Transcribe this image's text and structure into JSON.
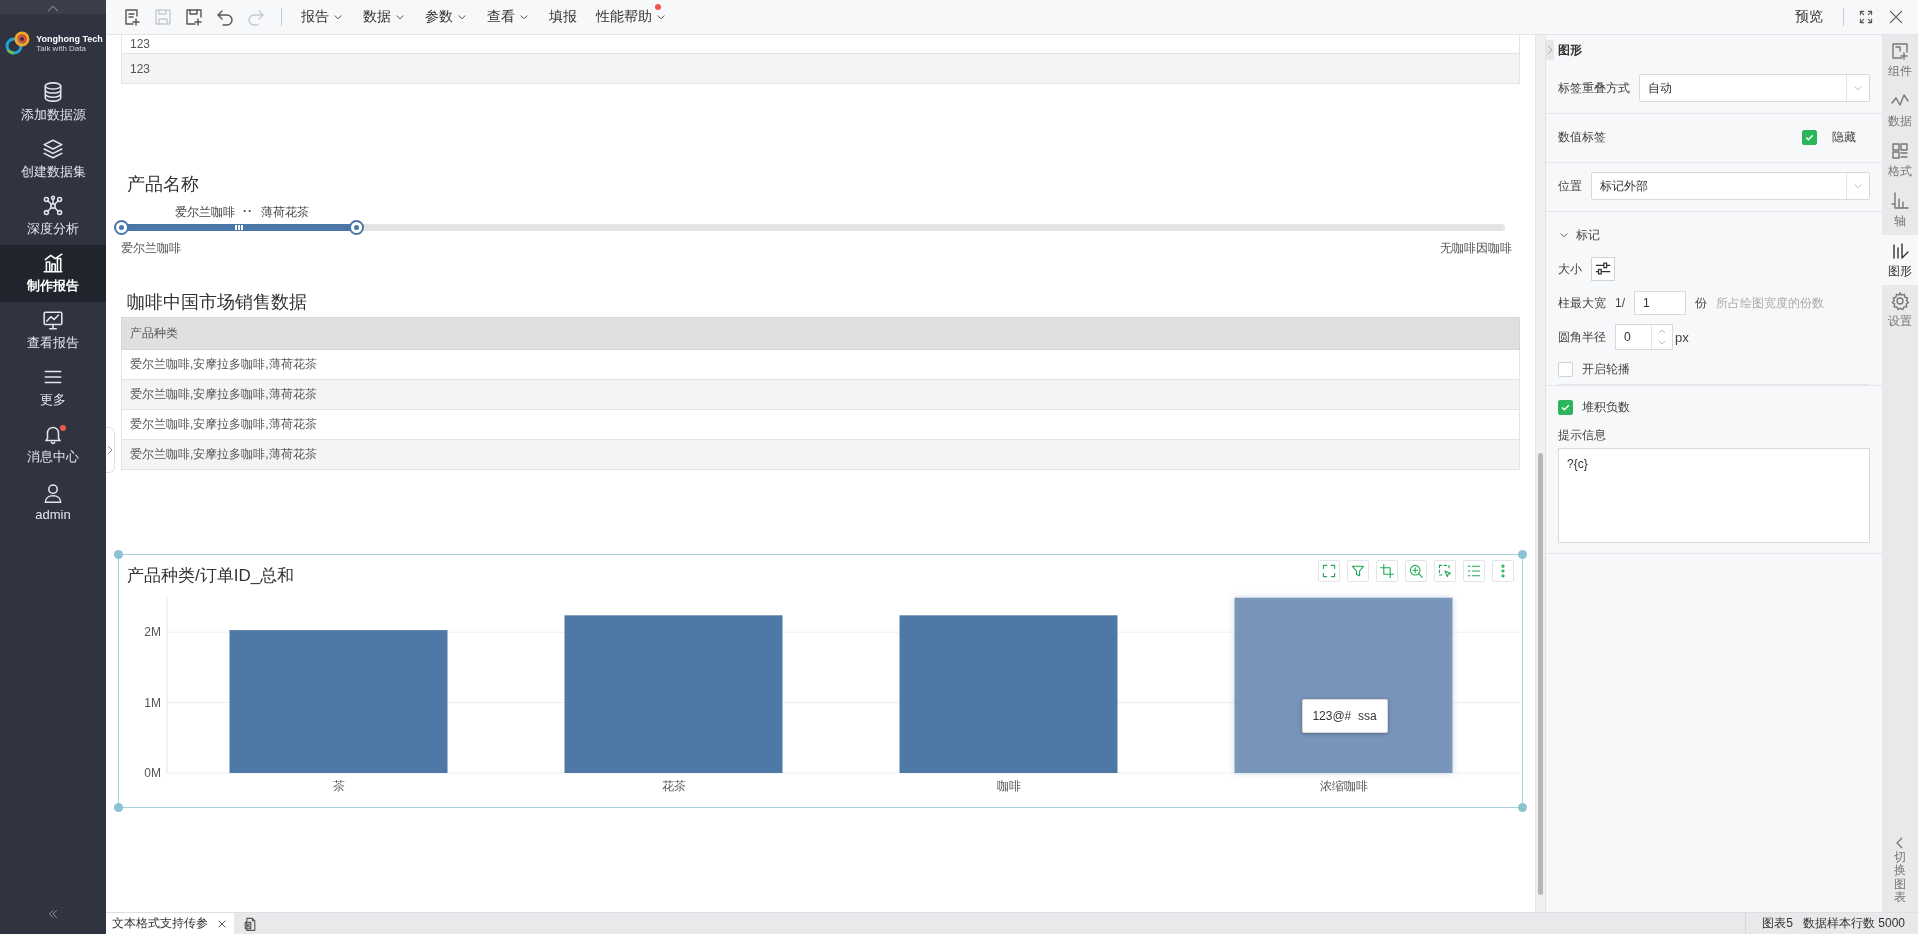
{
  "sidebar": {
    "brand": {
      "name": "Yonghong Tech",
      "tagline": "Talk with Data"
    },
    "items": [
      {
        "label": "添加数据源",
        "selected": false,
        "badge": false
      },
      {
        "label": "创建数据集",
        "selected": false,
        "badge": false
      },
      {
        "label": "深度分析",
        "selected": false,
        "badge": false
      },
      {
        "label": "制作报告",
        "selected": true,
        "badge": false
      },
      {
        "label": "查看报告",
        "selected": false,
        "badge": false
      },
      {
        "label": "更多",
        "selected": false,
        "badge": false
      },
      {
        "label": "消息中心",
        "selected": false,
        "badge": true
      },
      {
        "label": "admin",
        "selected": false,
        "badge": false
      }
    ]
  },
  "toolbar": {
    "actions": [
      {
        "disabled": false
      },
      {
        "disabled": true
      },
      {
        "disabled": false
      },
      {
        "disabled": false
      },
      {
        "disabled": true
      }
    ],
    "menus": [
      {
        "label": "报告",
        "dropdown": true,
        "badge": false
      },
      {
        "label": "数据",
        "dropdown": true,
        "badge": false
      },
      {
        "label": "参数",
        "dropdown": true,
        "badge": false
      },
      {
        "label": "查看",
        "dropdown": true,
        "badge": false
      },
      {
        "label": "填报",
        "dropdown": false,
        "badge": false
      },
      {
        "label": "性能帮助",
        "dropdown": true,
        "badge": true
      }
    ],
    "preview": "预览"
  },
  "top_table": {
    "rows": [
      "123",
      "123"
    ]
  },
  "slider": {
    "title": "产品名称",
    "range_start": "爱尔兰咖啡",
    "separator": "··",
    "range_end": "薄荷花茶",
    "min_label": "爱尔兰咖啡",
    "max_label": "无咖啡因咖啡",
    "level": 0.17
  },
  "table": {
    "title": "咖啡中国市场销售数据",
    "columns": [
      "产品种类"
    ],
    "rows": [
      [
        "爱尔兰咖啡,安摩拉多咖啡,薄荷花茶"
      ],
      [
        "爱尔兰咖啡,安摩拉多咖啡,薄荷花茶"
      ],
      [
        "爱尔兰咖啡,安摩拉多咖啡,薄荷花茶"
      ],
      [
        "爱尔兰咖啡,安摩拉多咖啡,薄荷花茶"
      ]
    ]
  },
  "chart": {
    "chart_data": {
      "type": "bar",
      "title": "产品种类/订单ID_总和",
      "categories": [
        "茶",
        "花茶",
        "咖啡",
        "浓缩咖啡"
      ],
      "series": [
        {
          "color": "#4e79a7",
          "values": [
            2.03,
            2.24,
            2.24,
            2.49
          ]
        }
      ],
      "ylim": [
        0,
        2.5
      ],
      "yticks": [
        {
          "value": 0,
          "label": "0M"
        },
        {
          "value": 1,
          "label": "1M"
        },
        {
          "value": 2,
          "label": "2M"
        }
      ]
    },
    "bars": [
      {
        "selected": false
      },
      {
        "selected": false
      },
      {
        "selected": false
      },
      {
        "selected": true
      }
    ],
    "tooltip": "123@#  ssa"
  },
  "panel": {
    "title": "图形",
    "groups": [
      [
        {
          "kind": "select",
          "label": "标签重叠方式",
          "value": "自动"
        }
      ],
      [
        {
          "kind": "toggle",
          "label": "数值标签",
          "option": "隐藏",
          "checked": true
        }
      ],
      [
        {
          "kind": "select",
          "label": "位置",
          "value": "标记外部"
        }
      ],
      [
        {
          "kind": "section",
          "label": "标记",
          "expanded": true
        },
        {
          "kind": "size",
          "label": "大小"
        },
        {
          "kind": "ratio",
          "label": "柱最大宽",
          "prefix": "1/",
          "value": "1",
          "unit": "份",
          "hint": "所占绘图宽度的份数"
        },
        {
          "kind": "spinner",
          "label": "圆角半径",
          "value": "0",
          "unit": "px"
        },
        {
          "kind": "checkbox",
          "label": "开启轮播",
          "checked": false
        }
      ],
      [
        {
          "kind": "checkbox",
          "label": "堆积负数",
          "checked": true
        },
        {
          "kind": "textarea",
          "label": "提示信息",
          "value": "?{c}"
        }
      ]
    ]
  },
  "right_tabs": [
    {
      "label": "组件",
      "selected": false
    },
    {
      "label": "数据",
      "selected": false
    },
    {
      "label": "格式",
      "selected": false
    },
    {
      "label": "轴",
      "selected": false
    },
    {
      "label": "图形",
      "selected": true
    },
    {
      "label": "设置",
      "selected": false
    }
  ],
  "switch_chart": "切换图表",
  "status_bar": {
    "tabs": [
      {
        "label": "文本格式支持传参",
        "selected": true
      }
    ],
    "chart_name": "图表5",
    "sample_rows": "数据样本行数 5000"
  }
}
